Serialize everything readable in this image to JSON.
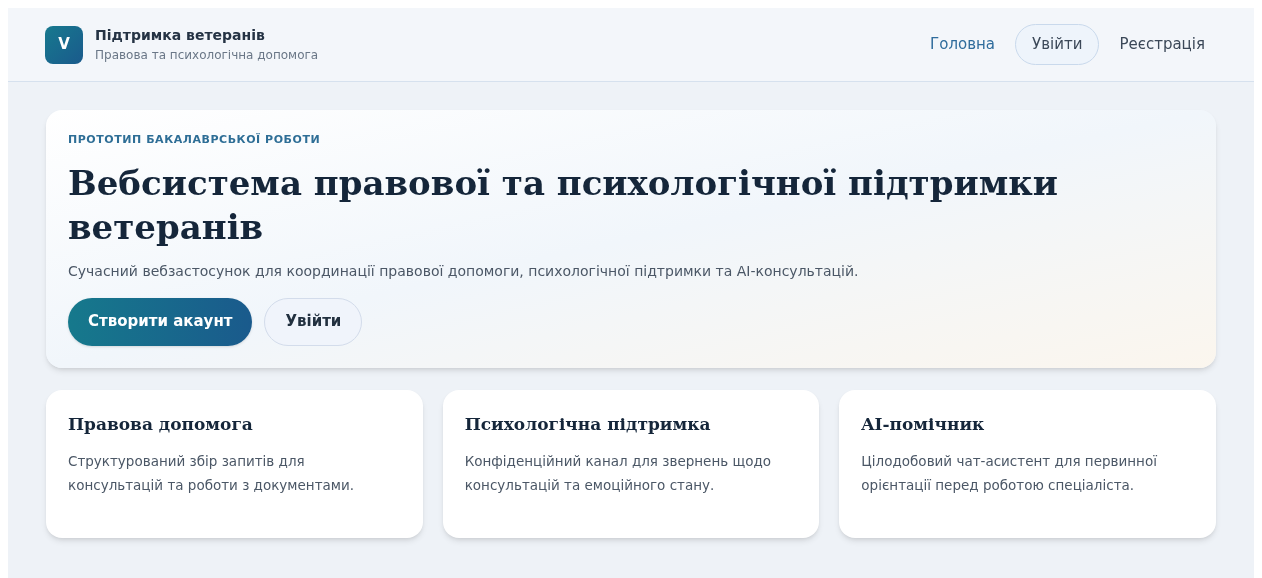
{
  "brand": {
    "logo": "V",
    "title": "Підтримка ветеранів",
    "subtitle": "Правова та психологічна допомога"
  },
  "nav": [
    {
      "label": "Головна",
      "kind": "link",
      "selected": true
    },
    {
      "label": "Увійти",
      "kind": "pill",
      "selected": false
    },
    {
      "label": "Реєстрація",
      "kind": "link",
      "selected": false
    }
  ],
  "hero": {
    "eyebrow": "ПРОТОТИП БАКАЛАВРСЬКОЇ РОБОТИ",
    "title": "Вебсистема правової та психологічної підтримки ветеранів",
    "description": "Сучасний вебзастосунок для координації правової допомоги, психологічної підтримки та AI-консультацій.",
    "buttons": [
      {
        "label": "Створити акаунт",
        "kind": "primary"
      },
      {
        "label": "Увійти",
        "kind": "secondary"
      }
    ]
  },
  "features": [
    {
      "title": "Правова допомога",
      "text": "Структурований збір запитів для консультацій та роботи з документами."
    },
    {
      "title": "Психологічна підтримка",
      "text": "Конфіденційний канал для звернень щодо консультацій та емоційного стану."
    },
    {
      "title": "AI-помічник",
      "text": "Цілодобовий чат-асистент для первинної орієнтації перед роботою спеціаліста."
    }
  ]
}
